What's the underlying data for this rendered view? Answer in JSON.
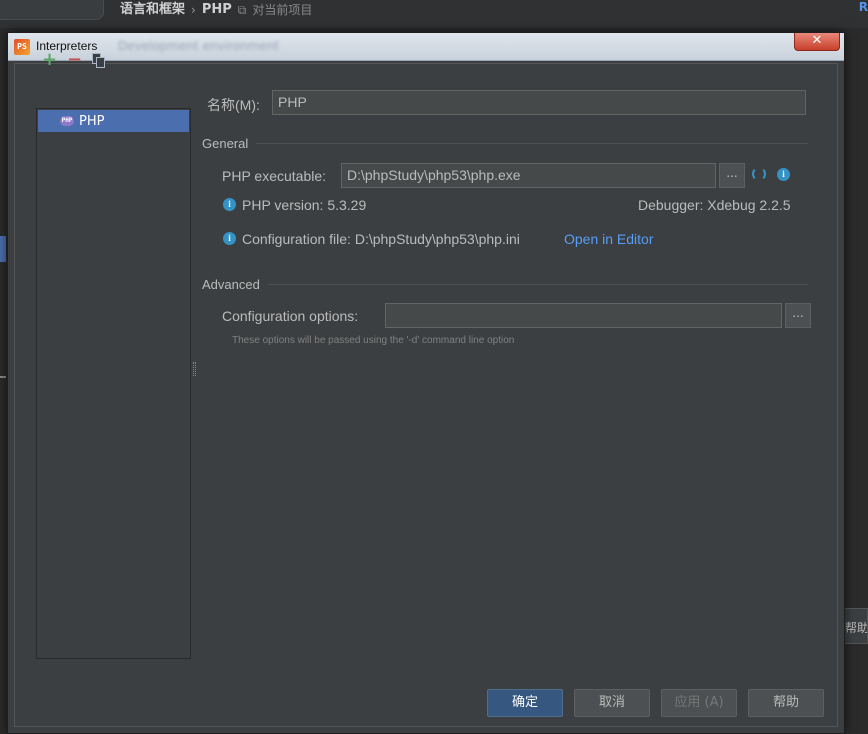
{
  "background": {
    "breadcrumb": [
      "语言和框架",
      "PHP"
    ],
    "scope_label": "对当前项目",
    "right_fragment": "R",
    "help_fragment": "帮助"
  },
  "dialog": {
    "title": "Interpreters",
    "title_ghost": "Development environment",
    "close_glyph": "✕",
    "toolbar": {
      "add": "+",
      "remove": "−"
    },
    "list": {
      "items": [
        {
          "label": "PHP",
          "icon_text": "PHP"
        }
      ]
    },
    "name_label": "名称(M):",
    "name_value": "PHP",
    "general": {
      "header": "General",
      "executable_label": "PHP executable:",
      "executable_value": "D:\\phpStudy\\php53\\php.exe",
      "browse_glyph": "...",
      "version_text": "PHP version: 5.3.29",
      "debugger_text": "Debugger: Xdebug 2.2.5",
      "config_file_text": "Configuration file: D:\\phpStudy\\php53\\php.ini",
      "open_in_editor": "Open in Editor"
    },
    "advanced": {
      "header": "Advanced",
      "options_label": "Configuration options:",
      "options_value": "",
      "browse_glyph": "...",
      "hint": "These options will be passed using the '-d' command line option"
    },
    "buttons": {
      "ok": "确定",
      "cancel": "取消",
      "apply": "应用 (A)",
      "help": "帮助"
    }
  },
  "colors": {
    "accent": "#4b6eaf",
    "link": "#589df6",
    "info": "#3592c4",
    "add": "#59a869",
    "remove": "#c75450"
  },
  "icons": [
    "add-icon",
    "remove-icon",
    "copy-icon",
    "php-icon",
    "info-icon",
    "refresh-icon",
    "close-icon"
  ]
}
